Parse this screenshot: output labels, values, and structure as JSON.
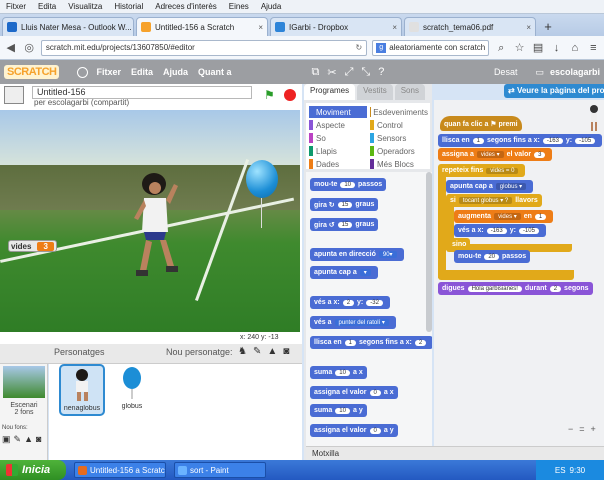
{
  "menubar": [
    "Fitxer",
    "Edita",
    "Visualitza",
    "Historial",
    "Adreces d'interès",
    "Eines",
    "Ajuda"
  ],
  "browser_tabs": [
    {
      "label": "Lluis Nater Mesa - Outlook W...",
      "color": "#1d69c9",
      "active": false
    },
    {
      "label": "Untitled-156 a Scratch",
      "color": "#f6a22c",
      "active": true
    },
    {
      "label": "IGarbi - Dropbox",
      "color": "#2d84d8",
      "active": false
    },
    {
      "label": "scratch_tema06.pdf",
      "color": "#e0e0e0",
      "active": false
    }
  ],
  "newtab_label": "+",
  "address": {
    "url": "scratch.mit.edu/projects/13607850/#editor",
    "search": "aleatoriamente con scratch"
  },
  "scratch_menu": {
    "logo": "SCRATCH",
    "items": [
      "Fitxer",
      "Edita",
      "Ajuda",
      "Quant a"
    ],
    "right_label": "Desat",
    "user": "escolagarbi"
  },
  "project": {
    "title": "Untitled-156",
    "by": "per escolagarbi (compartit)"
  },
  "variable_monitor": {
    "name": "vides",
    "value": "3"
  },
  "coords": "x: 240  y: -13",
  "sprites_panel": {
    "label": "Personatges",
    "new_sprite": "Nou personatge:",
    "stage_label": "Escenari",
    "stage_sub": "2 fons",
    "new_backdrop": "Nou fons:"
  },
  "sprites": [
    {
      "name": "nenaglobus",
      "selected": true
    },
    {
      "name": "globus",
      "selected": false
    }
  ],
  "palette": {
    "tabs": [
      "Programes",
      "Vestits",
      "Sons"
    ],
    "categories_left": [
      {
        "label": "Moviment",
        "color": "#4a6cd4",
        "selected": true
      },
      {
        "label": "Aspecte",
        "color": "#8a55d7"
      },
      {
        "label": "So",
        "color": "#bb42c3"
      },
      {
        "label": "Llapis",
        "color": "#0e9a6c"
      },
      {
        "label": "Dades",
        "color": "#ee7d16"
      }
    ],
    "categories_right": [
      {
        "label": "Esdeveniments",
        "color": "#c88a1c"
      },
      {
        "label": "Control",
        "color": "#e1a91a"
      },
      {
        "label": "Sensors",
        "color": "#2ca5e2"
      },
      {
        "label": "Operadors",
        "color": "#5cb712"
      },
      {
        "label": "Més Blocs",
        "color": "#632d99"
      }
    ],
    "blocks": [
      {
        "cls": "mot",
        "parts": [
          "mou-te ",
          {
            "s": "10"
          },
          " passos"
        ]
      },
      {
        "cls": "mot",
        "parts": [
          "gira ↻ ",
          {
            "s": "15"
          },
          " graus"
        ]
      },
      {
        "cls": "mot",
        "parts": [
          "gira ↺ ",
          {
            "s": "15"
          },
          " graus"
        ]
      },
      {
        "cls": "mot",
        "parts": [
          "apunta en direcció ",
          {
            "d": "90▾"
          }
        ]
      },
      {
        "cls": "mot",
        "parts": [
          "apunta cap a ",
          {
            "d": "▾"
          }
        ]
      },
      {
        "cls": "mot",
        "parts": [
          "vés a x: ",
          {
            "s": "2"
          },
          " y: ",
          {
            "s": "-32"
          }
        ]
      },
      {
        "cls": "mot",
        "parts": [
          "vés a ",
          {
            "d": "punter del ratolí ▾"
          }
        ]
      },
      {
        "cls": "mot",
        "parts": [
          "llisca en ",
          {
            "s": "1"
          },
          " segons fins a x: ",
          {
            "s": "2"
          }
        ]
      },
      {
        "cls": "mot",
        "parts": [
          "suma ",
          {
            "s": "10"
          },
          " a x"
        ]
      },
      {
        "cls": "mot",
        "parts": [
          "assigna el valor ",
          {
            "s": "0"
          },
          " a x"
        ]
      },
      {
        "cls": "mot",
        "parts": [
          "suma ",
          {
            "s": "10"
          },
          " a y"
        ]
      },
      {
        "cls": "mot",
        "parts": [
          "assigna el valor ",
          {
            "s": "0"
          },
          " a y"
        ]
      }
    ]
  },
  "edit_button": "Veure la pàgina del projecte",
  "script_blocks": [
    {
      "cls": "ev",
      "parts": [
        "quan fa clic a ⚑ premi"
      ]
    },
    {
      "cls": "mot",
      "parts": [
        "llisca en ",
        {
          "s": "1"
        },
        " segons fins a x: ",
        {
          "s": "-163"
        },
        " y: ",
        {
          "s": "-105"
        }
      ]
    },
    {
      "cls": "dat",
      "parts": [
        "assigna a ",
        {
          "d": "vides ▾"
        },
        " el valor ",
        {
          "s": "3"
        }
      ]
    },
    {
      "cls": "ctl",
      "parts": [
        "repeteix fins ",
        {
          "d": "vides = 0"
        }
      ]
    },
    {
      "cls": "mot",
      "parts": [
        "apunta cap a ",
        {
          "d": "globus ▾"
        }
      ]
    },
    {
      "cls": "ctl",
      "parts": [
        "si ",
        {
          "d": "tocant globus ▾ ?"
        },
        " llavors"
      ]
    },
    {
      "cls": "dat",
      "parts": [
        "augmenta ",
        {
          "d": "vides ▾"
        },
        " en ",
        {
          "s": "1"
        }
      ]
    },
    {
      "cls": "mot",
      "parts": [
        "vés a x: ",
        {
          "s": "-163"
        },
        " y: ",
        {
          "s": "-105"
        }
      ]
    },
    {
      "cls": "ctl",
      "parts": [
        "sino"
      ]
    },
    {
      "cls": "mot",
      "parts": [
        "mou-te ",
        {
          "s": "20"
        },
        " passos"
      ]
    },
    {
      "cls": "lks",
      "parts": [
        "digues ",
        {
          "s": "Hola garbisianes!"
        },
        " durant ",
        {
          "s": "2"
        },
        " segons"
      ]
    }
  ],
  "zoom_controls": [
    "−",
    "=",
    "+"
  ],
  "backpack": "Motxilla",
  "taskbar": {
    "start": "Inicia",
    "tasks": [
      {
        "label": "Untitled-156 a Scratch...",
        "color": "#e56b1f"
      },
      {
        "label": "sort - Paint",
        "color": "#6bb3ff"
      }
    ],
    "lang": "ES",
    "clock": "9:30"
  },
  "colors": {
    "scratch_header": "#9c9ea2",
    "accent": "#2e8ad1"
  }
}
